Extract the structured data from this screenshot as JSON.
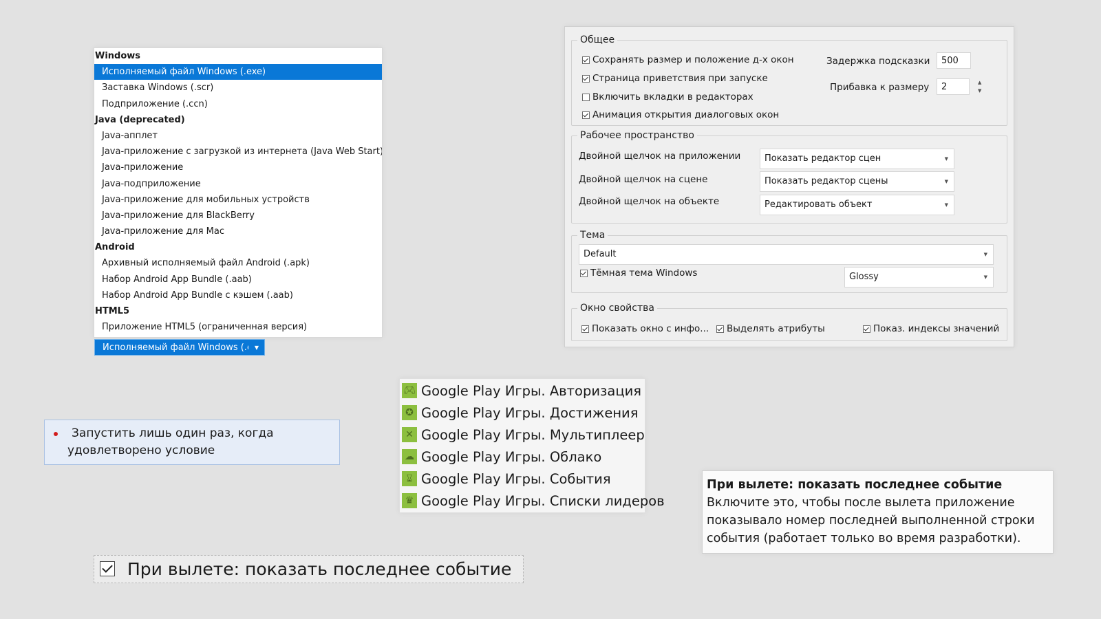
{
  "export": {
    "groups": [
      {
        "title": "Windows",
        "items": [
          {
            "label": "Исполняемый файл Windows (.exe)",
            "selected": true
          },
          {
            "label": "Заставка Windows (.scr)",
            "selected": false
          },
          {
            "label": "Подприложение (.ccn)",
            "selected": false
          }
        ]
      },
      {
        "title": "Java (deprecated)",
        "items": [
          {
            "label": "Java-апплет",
            "selected": false
          },
          {
            "label": "Java-приложение с загрузкой из интернета (Java Web Start)",
            "selected": false
          },
          {
            "label": "Java-приложение",
            "selected": false
          },
          {
            "label": "Java-подприложение",
            "selected": false
          },
          {
            "label": "Java-приложение для мобильных устройств",
            "selected": false
          },
          {
            "label": "Java-приложение для BlackBerry",
            "selected": false
          },
          {
            "label": "Java-приложение для Mac",
            "selected": false
          }
        ]
      },
      {
        "title": "Android",
        "items": [
          {
            "label": "Архивный исполняемый файл Android (.apk)",
            "selected": false
          },
          {
            "label": "Набор Android App Bundle (.aab)",
            "selected": false
          },
          {
            "label": "Набор Android App Bundle с кэшем (.aab)",
            "selected": false
          }
        ]
      },
      {
        "title": "HTML5",
        "items": [
          {
            "label": "Приложение HTML5 (ограниченная версия)",
            "selected": false
          }
        ]
      }
    ],
    "combo_value": "Исполняемый файл Windows (.e›"
  },
  "prefs": {
    "general": {
      "title": "Общее",
      "chk_save_size": {
        "label": "Сохранять размер и положение д-х окон",
        "checked": true
      },
      "chk_welcome": {
        "label": "Страница приветствия при запуске",
        "checked": true
      },
      "chk_tabs": {
        "label": "Включить вкладки в редакторах",
        "checked": false
      },
      "chk_anim": {
        "label": "Анимация открытия диалоговых окон",
        "checked": true
      },
      "tooltip_delay_label": "Задержка подсказки",
      "tooltip_delay_value": "500",
      "size_inc_label": "Прибавка к размеру",
      "size_inc_value": "2"
    },
    "workspace": {
      "title": "Рабочее пространство",
      "dbl_app_label": "Двойной щелчок на приложении",
      "dbl_app_value": "Показать редактор сцен",
      "dbl_scene_label": "Двойной щелчок на сцене",
      "dbl_scene_value": "Показать редактор сцены",
      "dbl_obj_label": "Двойной щелчок на объекте",
      "dbl_obj_value": "Редактировать объект"
    },
    "theme": {
      "title": "Тема",
      "value": "Default",
      "dark_label": "Тёмная тема Windows",
      "dark_checked": true,
      "style_value": "Glossy"
    },
    "props": {
      "title": "Окно свойства",
      "show_info": "Показать окно с инфо...",
      "highlight_attrs": "Выделять атрибуты",
      "show_indexes": "Показ. индексы значений"
    }
  },
  "run_once": {
    "line1": "Запустить лишь один раз, когда",
    "line2": "удовлетворено условие",
    "dot_color": "#d21c1c"
  },
  "google_play": {
    "icon_color": "#8cbf3f",
    "items": [
      {
        "label": "Google Play Игры. Авторизация",
        "icon": "gamepad-icon"
      },
      {
        "label": "Google Play Игры. Достижения",
        "icon": "award-icon"
      },
      {
        "label": "Google Play Игры. Мультиплеер",
        "icon": "crossed-swords-icon"
      },
      {
        "label": "Google Play Игры. Облако",
        "icon": "cloud-icon"
      },
      {
        "label": "Google Play Игры. События",
        "icon": "hourglass-icon"
      },
      {
        "label": "Google Play Игры. Списки лидеров",
        "icon": "crown-icon"
      }
    ]
  },
  "tooltip": {
    "title": "При вылете: показать последнее событие",
    "body": "Включите это, чтобы после вылета приложение показывало номер последней выполненной строки события (работает только во время разработки)."
  },
  "crash_checkbox": {
    "label": "При вылете: показать последнее событие",
    "checked": true
  },
  "colors": {
    "accent": "#0a78d7",
    "background": "#e2e2e2"
  }
}
